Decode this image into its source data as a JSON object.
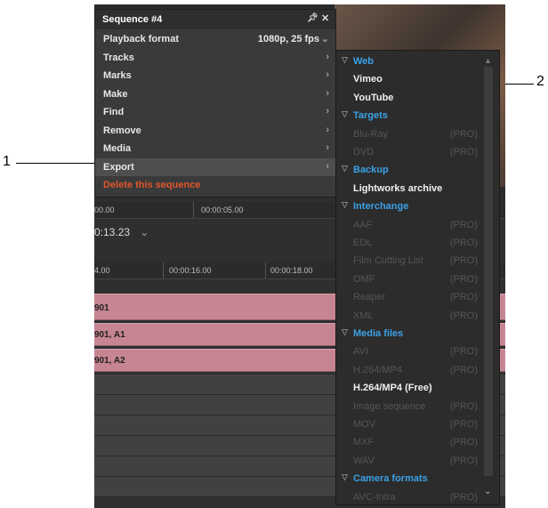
{
  "callouts": [
    {
      "number": "1"
    },
    {
      "number": "2"
    }
  ],
  "sequence_menu": {
    "title": "Sequence #4",
    "pin_icon": "pin-icon",
    "close_icon": "close-icon",
    "items": [
      {
        "label": "Playback format",
        "value": "1080p, 25 fps",
        "arrow": "⌄"
      },
      {
        "label": "Tracks",
        "arrow": "›"
      },
      {
        "label": "Marks",
        "arrow": "›"
      },
      {
        "label": "Make",
        "arrow": "›"
      },
      {
        "label": "Find",
        "arrow": "›"
      },
      {
        "label": "Remove",
        "arrow": "›"
      },
      {
        "label": "Media",
        "arrow": "›"
      },
      {
        "label": "Export",
        "arrow": "›",
        "selected": true
      },
      {
        "label": "Delete this sequence",
        "danger": true
      }
    ]
  },
  "export_submenu": {
    "pro_label": "(PRO)",
    "sections": [
      {
        "title": "Web",
        "items": [
          {
            "label": "Vimeo",
            "enabled": true
          },
          {
            "label": "YouTube",
            "enabled": true
          }
        ]
      },
      {
        "title": "Targets",
        "items": [
          {
            "label": "Blu-Ray",
            "enabled": false
          },
          {
            "label": "DVD",
            "enabled": false
          }
        ]
      },
      {
        "title": "Backup",
        "items": [
          {
            "label": "Lightworks archive",
            "enabled": true
          }
        ]
      },
      {
        "title": "Interchange",
        "items": [
          {
            "label": "AAF",
            "enabled": false
          },
          {
            "label": "EDL",
            "enabled": false
          },
          {
            "label": "Film Cutting List",
            "enabled": false
          },
          {
            "label": "OMF",
            "enabled": false
          },
          {
            "label": "Reaper",
            "enabled": false
          },
          {
            "label": "XML",
            "enabled": false
          }
        ]
      },
      {
        "title": "Media files",
        "items": [
          {
            "label": "AVI",
            "enabled": false
          },
          {
            "label": "H.264/MP4",
            "enabled": false
          },
          {
            "label": "H.264/MP4 (Free)",
            "enabled": true
          },
          {
            "label": "Image sequence",
            "enabled": false
          },
          {
            "label": "MOV",
            "enabled": false
          },
          {
            "label": "MXF",
            "enabled": false
          },
          {
            "label": "WAV",
            "enabled": false
          }
        ]
      },
      {
        "title": "Camera formats",
        "items": [
          {
            "label": "AVC-Intra",
            "enabled": false
          }
        ]
      }
    ]
  },
  "timeline": {
    "ruler1": [
      "00.00",
      "00:00:05.00"
    ],
    "timecode": "0:13.23",
    "timecode_dropdown": "⌄",
    "ruler2": [
      "4.00",
      "00:00:16.00",
      "00:00:18.00"
    ],
    "clips": [
      "901",
      "901, A1",
      "901, A2"
    ]
  },
  "colors": {
    "section_header": "#3aa1e6",
    "danger": "#e0552c",
    "clip": "#c78592"
  }
}
